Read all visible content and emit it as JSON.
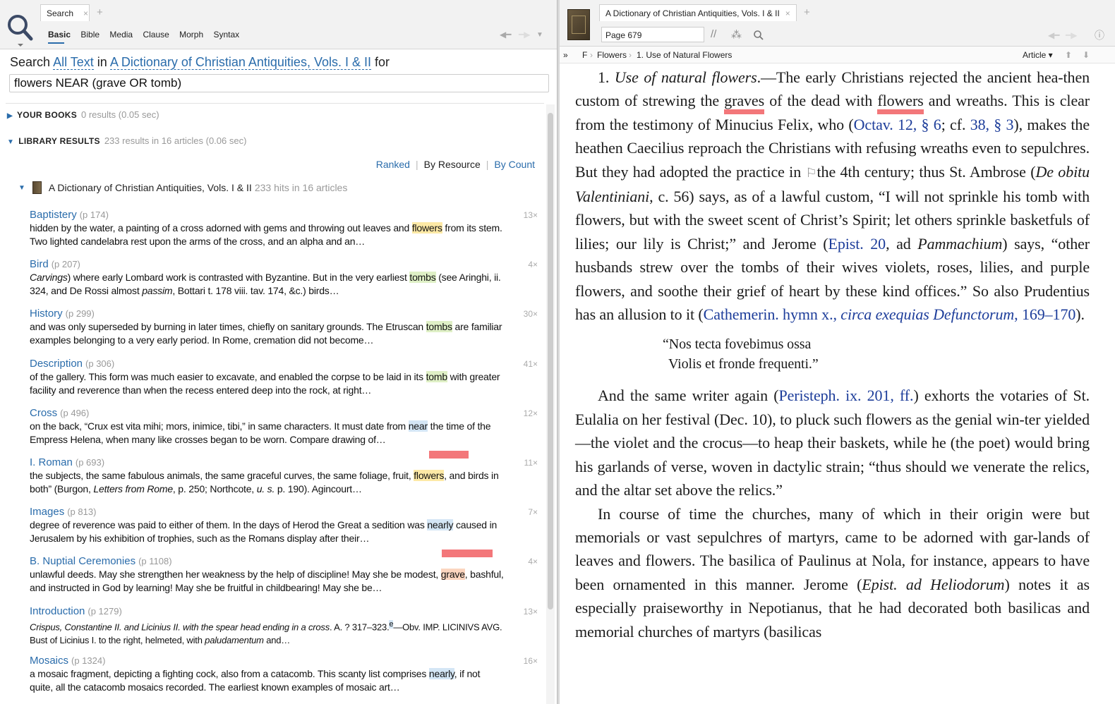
{
  "left": {
    "tab_label": "Search",
    "subtabs": [
      "Basic",
      "Bible",
      "Media",
      "Clause",
      "Morph",
      "Syntax"
    ],
    "search_line": {
      "prefix": "Search",
      "scope": "All Text",
      "in": "in",
      "resource": "A Dictionary of Christian Antiquities, Vols. I & II",
      "for": "for"
    },
    "query": "flowers NEAR (grave OR tomb)",
    "your_books": {
      "label": "YOUR BOOKS",
      "meta": "0 results (0.05 sec)"
    },
    "library": {
      "label": "LIBRARY RESULTS",
      "meta": "233 results in 16 articles (0.06 sec)"
    },
    "sort": {
      "ranked": "Ranked",
      "by_resource": "By Resource",
      "by_count": "By Count"
    },
    "resource": {
      "title": "A Dictionary of Christian Antiquities, Vols. I & II",
      "meta": "233 hits in 16 articles"
    },
    "results": [
      {
        "title": "Baptistery",
        "page": "(p 174)",
        "count": "13×",
        "line1_a": "hidden by the water, a painting of a cross adorned with gems and throwing out leaves and ",
        "hit": "flowers",
        "line1_b": " from its stem.",
        "line2": "Two lighted candelabra rest upon the arms of the cross, and an alpha and an…"
      },
      {
        "title": "Bird",
        "page": "(p 207)",
        "count": "4×",
        "line1_i": "Carvings",
        "line1_a": ") where early Lombard work is contrasted with Byzantine. But in the very earliest ",
        "hit": "tombs",
        "line1_b": " (see Aringhi, ii.",
        "line2_a": "324, and De Rossi almost ",
        "line2_i": "passim",
        "line2_b": ", Bottari t. 178 viii. tav. 174, &c.) birds…"
      },
      {
        "title": "History",
        "page": "(p 299)",
        "count": "30×",
        "line1_a": "and was only superseded by burning in later times, chiefly on sanitary grounds. The Etruscan ",
        "hit": "tombs",
        "line1_b": " are familiar",
        "line2": "examples belonging to a very early period. In Rome, cremation did not become…"
      },
      {
        "title": "Description",
        "page": "(p 306)",
        "count": "41×",
        "line1_a": "of the gallery. This form was much easier to excavate, and enabled the corpse to be laid in its ",
        "hit": "tomb",
        "line1_b": " with greater",
        "line2": "facility and reverence than when the recess entered deep into the rock, at right…"
      },
      {
        "title": "Cross",
        "page": "(p 496)",
        "count": "12×",
        "line1_a": "on the back, “Crux est vita mihi; mors, inimice, tibi,” in same characters. It must date from ",
        "hit": "near",
        "line1_b": " the time of the",
        "line2": "Empress Helena, when many like crosses began to be worn. Compare drawing of…"
      },
      {
        "title": "I. Roman",
        "page": "(p 693)",
        "count": "11×",
        "line1_a": "the subjects, the same fabulous animals, the same graceful curves, the same foliage, fruit, ",
        "hit": "flowers",
        "line1_b": ", and birds in",
        "line2_a": "both” (Burgon, ",
        "line2_i": "Letters from Rome",
        "line2_b": ", p. 250; Northcote, ",
        "line2_i2": "u. s.",
        "line2_c": " p. 190). Agincourt…"
      },
      {
        "title": "Images",
        "page": "(p 813)",
        "count": "7×",
        "line1_a": "degree of reverence was paid to either of them. In the days of Herod the Great a sedition was ",
        "hit": "nearly",
        "line1_b": " caused in",
        "line2": "Jerusalem by his exhibition of trophies, such as the Romans display after their…"
      },
      {
        "title": "B. Nuptial Ceremonies",
        "page": "(p 1108)",
        "count": "4×",
        "line1_a": "unlawful deeds. May she strengthen her weakness by the help of discipline! May she be modest, ",
        "hit": "grave",
        "line1_b": ", bashful,",
        "line2": "and instructed in God by learning! May she be fruitful in childbearing! May she be…"
      },
      {
        "title": "Introduction",
        "page": "(p 1279)",
        "count": "13×",
        "line1_i": "Crispus, Constantine II. and Licinius II. with the spear head ending in a cross",
        "line1_a": ". A. ? 317–323.",
        "hit": "e",
        "line1_b": "—Obv. IMP. LICINIVS AVG.",
        "line2_a": "Bust of Licinius I. to the right, helmeted, with ",
        "line2_i": "paludamentum",
        "line2_b": " and…"
      },
      {
        "title": "Mosaics",
        "page": "(p 1324)",
        "count": "16×",
        "line1_a": "a mosaic fragment, depicting a fighting cock, also from a catacomb. This scanty list comprises ",
        "hit": "nearly",
        "line1_b": ", if not",
        "line2": "quite, all the catacomb mosaics recorded. The earliest known examples of mosaic art…"
      }
    ]
  },
  "right": {
    "tab_label": "A Dictionary of Christian Antiquities, Vols. I & II",
    "page_box": "Page 679",
    "breadcrumb": [
      "»",
      "F",
      "Flowers",
      "1. Use of Natural Flowers"
    ],
    "view_mode": "Article ▾",
    "article": {
      "p1_a": "1. ",
      "p1_i": "Use of natural flowers",
      "p1_b": ".—The early Christians rejected the ancient hea-then custom of strewing the ",
      "p1_graves": "graves",
      "p1_c": " of the dead with ",
      "p1_flowers": "flowers",
      "p1_d": " and wreaths. This is clear from the testimony of Minucius Felix, who (",
      "p1_link1": "Octav. 12, § 6",
      "p1_e": "; cf. ",
      "p1_link2": "38, § 3",
      "p1_f": "), makes the heathen Caecilius reproach the Christians with refusing wreaths even to sepulchres. But they had adopted the practice in ",
      "p1_g": "the 4th century; thus St. Ambrose (",
      "p1_i2": "De obitu Valentiniani",
      "p1_h": ", c. 56) says, as of a lawful custom, “I will not sprinkle his tomb with flowers, but with the sweet scent of Christ’s Spirit; let others sprinkle basketfuls of lilies; our lily is Christ;” and Jerome (",
      "p1_link3": "Epist. 20",
      "p1_j": ", ad ",
      "p1_i3": "Pammachium",
      "p1_k": ") says, “other husbands strew over the tombs of their wives violets, roses, lilies, and purple flowers, and soothe their grief of heart by these kind offices.” So also Prudentius has an allusion to it (",
      "p1_link4a": "Cathemerin. hymn x., ",
      "p1_link4i": "circa exequias Defunctorum",
      "p1_link4b": ", 169–170",
      "p1_l": ").",
      "poem1": "“Nos tecta fovebimus ossa",
      "poem2": "Violis et fronde frequenti.”",
      "p2_a": "And the same writer again (",
      "p2_link": "Peristeph. ix. 201, ff.",
      "p2_b": ") exhorts the votaries of St. Eulalia on her festival (Dec. 10), to pluck such flowers as the genial win-ter yielded—the violet and the crocus—to heap their baskets, while he (the poet) would bring his garlands of verse, woven in dactylic strain; “thus should we venerate the relics, and the altar set above the relics.”",
      "p3_a": "In course of time the churches, many of which in their origin were but memorials or vast sepulchres of martyrs, came to be adorned with gar-lands of leaves and flowers. The basilica of Paulinus at Nola, for instance, appears to have been ornamented in this manner. Jerome (",
      "p3_i": "Epist. ad Heliodorum",
      "p3_b": ") notes it as especially praiseworthy in Nepotianus, that he had decorated both basilicas and memorial churches of martyrs (basilicas"
    }
  },
  "colors": {
    "link": "#2a6cab",
    "article_link": "#1d3d9a",
    "hit_yellow": "#fde9a6",
    "hit_green": "#dff0c6",
    "hit_blue": "#d4e6f5",
    "hit_orange": "#fbd5bf",
    "annotation_red": "#f3777a"
  }
}
